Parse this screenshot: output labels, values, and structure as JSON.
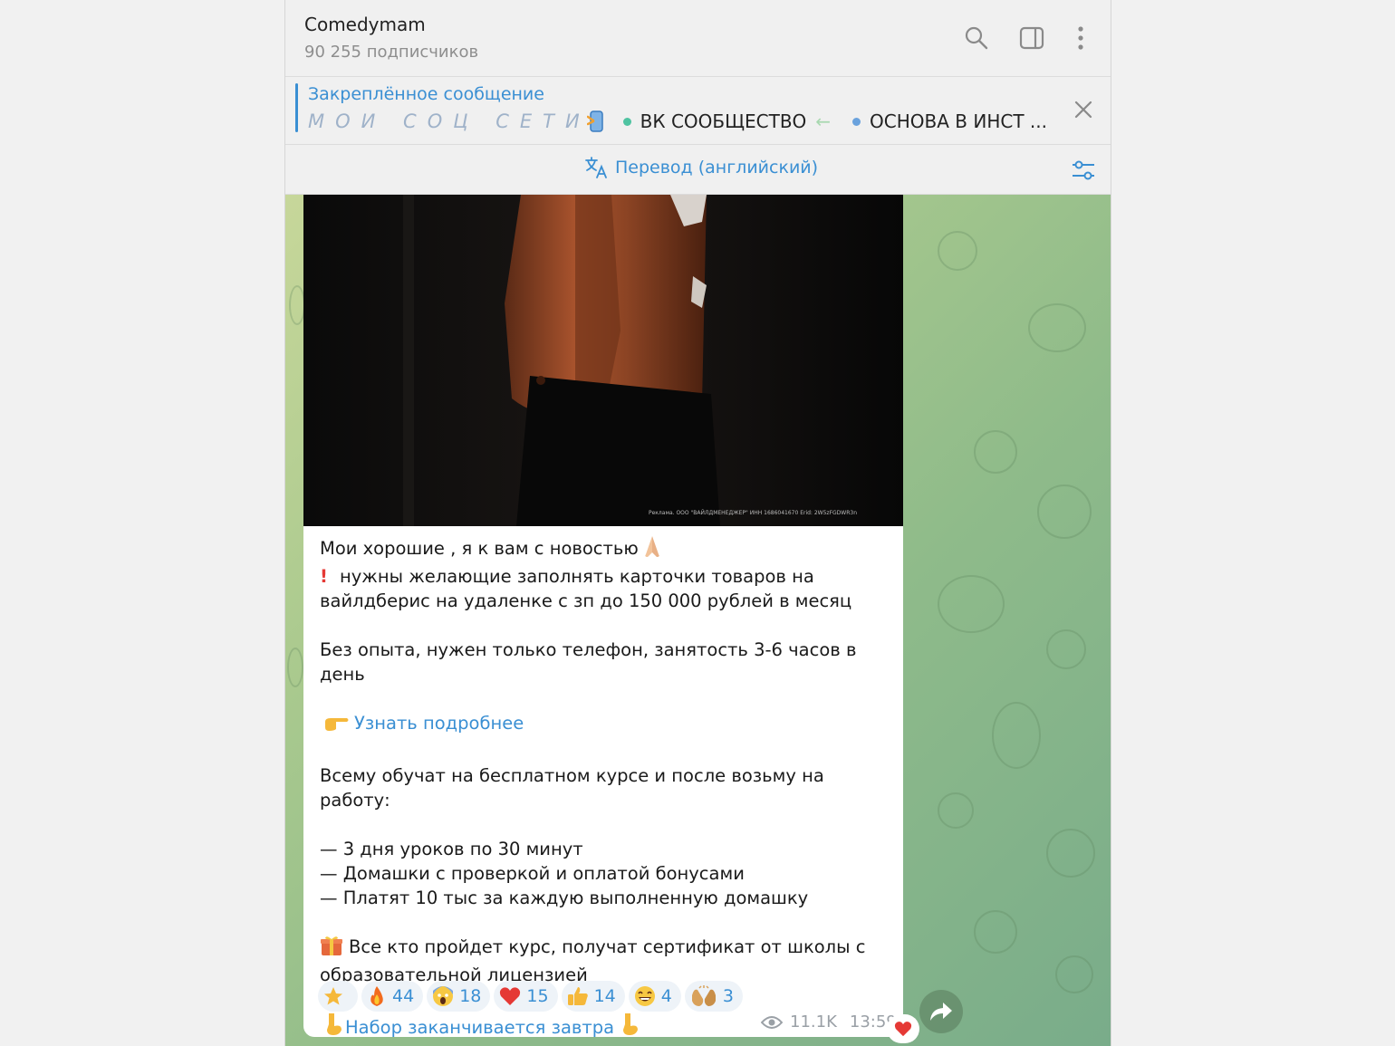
{
  "channel": {
    "title": "Comedymam",
    "subscribers": "90 255 подписчиков"
  },
  "header_icons": [
    "search-icon",
    "sidebar-toggle-icon",
    "more-vertical-icon"
  ],
  "pinned": {
    "title": "Закреплённое сообщение",
    "spaced_text": "МОИ СОЦ СЕТИ",
    "item1": "ВК СООБЩЕСТВО",
    "item1_suffix": "←",
    "item2": "ОСНОВА В ИНСТ ...",
    "dot1_color": "#4fc3a1",
    "dot2_color": "#6aa2dd"
  },
  "translate": {
    "label": "Перевод (английский)"
  },
  "post": {
    "ad_label": "Реклама. ООО \"ВАЙЛДМЕНЕДЖЕР\" ИНН 1686041670 Erid: 2W5zFGDWR3n",
    "line1": "Мои хорошие , я к вам с новостью",
    "line2": "нужны желающие заполнять карточки товаров на",
    "line3": "вайлдберис на удаленке с зп до 150 000 рублей в месяц",
    "line4": "Без опыта, нужен только телефон, занятость 3-6 часов в день",
    "link1": "Узнать подробнее",
    "line5": "Всему обучат на бесплатном курсе и после возьму на работу:",
    "bullet1": "— 3 дня уроков по 30 минут",
    "bullet2": "— Домашки с проверкой и оплатой бонусами",
    "bullet3": "— Платят 10 тыс за каждую выполненную домашку",
    "line6": "Все кто пройдет курс, получат сертификат от школы с",
    "line7": "образовательной лицензией",
    "link2": "Набор заканчивается завтра"
  },
  "reactions": [
    {
      "icon": "star-icon",
      "count": ""
    },
    {
      "icon": "fire-icon",
      "count": "44"
    },
    {
      "icon": "scream-icon",
      "count": "18"
    },
    {
      "icon": "heart-icon",
      "count": "15"
    },
    {
      "icon": "thumbs-up-icon",
      "count": "14"
    },
    {
      "icon": "grin-icon",
      "count": "4"
    },
    {
      "icon": "hands-icon",
      "count": "3"
    }
  ],
  "meta": {
    "views": "11.1K",
    "time": "13:59"
  },
  "colors": {
    "accent": "#3a8fd3",
    "heart": "#e53935"
  }
}
